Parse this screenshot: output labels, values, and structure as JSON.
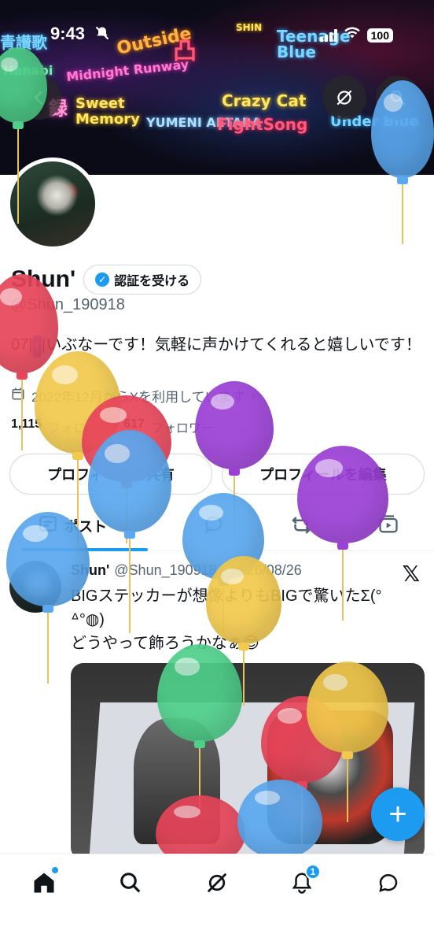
{
  "status_bar": {
    "time": "9:43",
    "battery": "100"
  },
  "banner": {
    "neon_texts": [
      "青讃歌",
      "Outside",
      "SHIN",
      "Teenage Blue",
      "Hanabi",
      "Midnight Runway",
      "Sweet Memory",
      "YUMENI AETARA",
      "FightSong",
      "Crazy Cat",
      "Under Blue",
      "凸",
      "録"
    ]
  },
  "profile": {
    "name": "Shun'",
    "verify_label": "認証を受ける",
    "handle": "@Shun_190918",
    "bio_prefix": "07|",
    "bio_badge": "i",
    "bio_text": "|いぶなーです！気軽に声かけてくれると嬉しいです！",
    "joined": "2022年12月からXを利用しています",
    "following_count": "1,115",
    "following_label": "フォロー中",
    "followers_count": "617",
    "followers_label": "フォロワー"
  },
  "actions": {
    "share_label": "プロフィールを共有",
    "edit_label": "プロフィールを編集"
  },
  "tabs": {
    "posts_label": "ポスト"
  },
  "post": {
    "author": "Shun'",
    "handle": "@Shun_190918",
    "date": "2026/08/26",
    "line1": "BIGステッカーが想像よりもBIGで驚いたΣ(°",
    "line2": "ᐞ°◍)",
    "line3": "どうやって飾ろうかなぁ😊"
  },
  "nav": {
    "notification_count": "1"
  },
  "colors": {
    "accent": "#1d9bf0",
    "balloon_red": "#e8455a",
    "balloon_yellow": "#f2c94c",
    "balloon_blue": "#5aa8ef",
    "balloon_purple": "#9b3fd6",
    "balloon_green": "#4fd08a"
  }
}
